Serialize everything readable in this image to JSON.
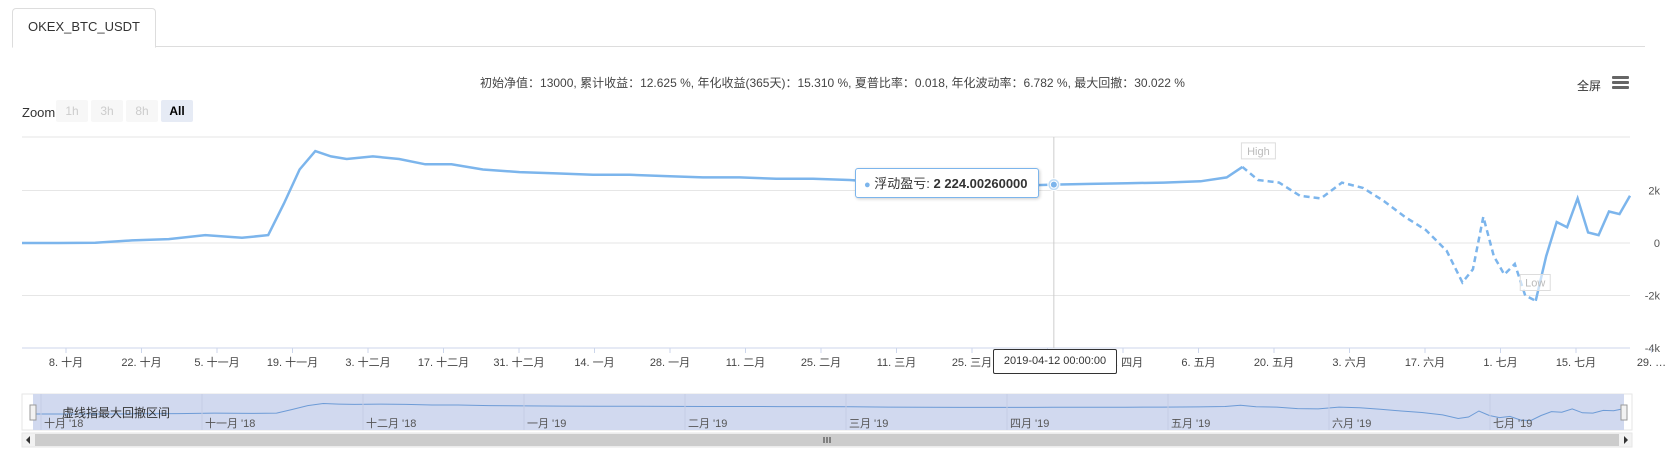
{
  "tab": {
    "label": "OKEX_BTC_USDT"
  },
  "stats_text": "初始净值：13000, 累计收益：12.625 %, 年化收益(365天)：15.310 %, 夏普比率：0.018, 年化波动率：6.782 %, 最大回撤：30.022 %",
  "toolbar": {
    "fullscreen_label": "全屏",
    "menu_icon": "hamburger-menu-icon"
  },
  "zoom": {
    "label": "Zoom",
    "buttons": [
      "1h",
      "3h",
      "8h",
      "All"
    ],
    "active": "All"
  },
  "tooltip": {
    "series_name": "浮动盈亏",
    "value_text": "2 224.00260000"
  },
  "crosshair_label": "2019-04-12 00:00:00",
  "navigator_note": "虚线指最大回撤区间",
  "flags": {
    "high": "High",
    "low": "Low"
  },
  "chart_data": {
    "type": "line",
    "series": [
      {
        "name": "浮动盈亏",
        "x": [
          "2018-09-27",
          "2018-10-04",
          "2018-10-11",
          "2018-10-18",
          "2018-10-25",
          "2018-11-01",
          "2018-11-08",
          "2018-11-13",
          "2018-11-16",
          "2018-11-19",
          "2018-11-22",
          "2018-11-25",
          "2018-11-28",
          "2018-12-03",
          "2018-12-08",
          "2018-12-13",
          "2018-12-18",
          "2018-12-24",
          "2018-12-31",
          "2019-01-07",
          "2019-01-14",
          "2019-01-21",
          "2019-01-28",
          "2019-02-04",
          "2019-02-11",
          "2019-02-18",
          "2019-02-25",
          "2019-03-04",
          "2019-03-11",
          "2019-03-18",
          "2019-03-25",
          "2019-04-01",
          "2019-04-08",
          "2019-04-12",
          "2019-04-19",
          "2019-04-26",
          "2019-05-03",
          "2019-05-10",
          "2019-05-15",
          "2019-05-18",
          "2019-05-21",
          "2019-05-25",
          "2019-05-29",
          "2019-06-02",
          "2019-06-06",
          "2019-06-10",
          "2019-06-14",
          "2019-06-18",
          "2019-06-22",
          "2019-06-26",
          "2019-06-29",
          "2019-07-01",
          "2019-07-03",
          "2019-07-05",
          "2019-07-07",
          "2019-07-09",
          "2019-07-11",
          "2019-07-13",
          "2019-07-15",
          "2019-07-17",
          "2019-07-19",
          "2019-07-21",
          "2019-07-23",
          "2019-07-25",
          "2019-07-27",
          "2019-07-29",
          "2019-07-31"
        ],
        "y": [
          0,
          0,
          10,
          100,
          150,
          300,
          200,
          300,
          1500,
          2800,
          3500,
          3300,
          3200,
          3300,
          3200,
          3000,
          3000,
          2800,
          2700,
          2650,
          2600,
          2600,
          2550,
          2500,
          2500,
          2450,
          2450,
          2400,
          2300,
          2250,
          2200,
          2200,
          2200,
          2224,
          2250,
          2280,
          2300,
          2350,
          2500,
          2900,
          2400,
          2300,
          1800,
          1700,
          2300,
          2100,
          1600,
          1000,
          500,
          -300,
          -1500,
          -1000,
          1000,
          -500,
          -1200,
          -800,
          -2000,
          -2200,
          -500,
          800,
          600,
          1700,
          400,
          300,
          1200,
          1100,
          1800
        ]
      }
    ],
    "drawdown_start": "2019-05-18",
    "drawdown_end": "2019-07-13",
    "x_ticks": [
      "8. 十月",
      "22. 十月",
      "5. 十一月",
      "19. 十一月",
      "3. 十二月",
      "17. 十二月",
      "31. 十二月",
      "14. 一月",
      "28. 一月",
      "11. 二月",
      "25. 二月",
      "11. 三月",
      "25. 三月",
      "8. 四月",
      "22. 四月",
      "6. 五月",
      "20. 五月",
      "3. 六月",
      "17. 六月",
      "1. 七月",
      "15. 七月",
      "29. …"
    ],
    "y_ticks": [
      "2k",
      "0",
      "-2k",
      "-4k"
    ],
    "ylim": [
      -4000,
      4000
    ],
    "navigator_ticks": [
      "十月 '18",
      "十一月 '18",
      "十二月 '18",
      "一月 '19",
      "二月 '19",
      "三月 '19",
      "四月 '19",
      "五月 '19",
      "六月 '19",
      "七月 '19"
    ],
    "colors": {
      "line": "#7cb5ec",
      "grid": "#e6e6e6",
      "navigator_fill": "#d1d9ef"
    }
  }
}
